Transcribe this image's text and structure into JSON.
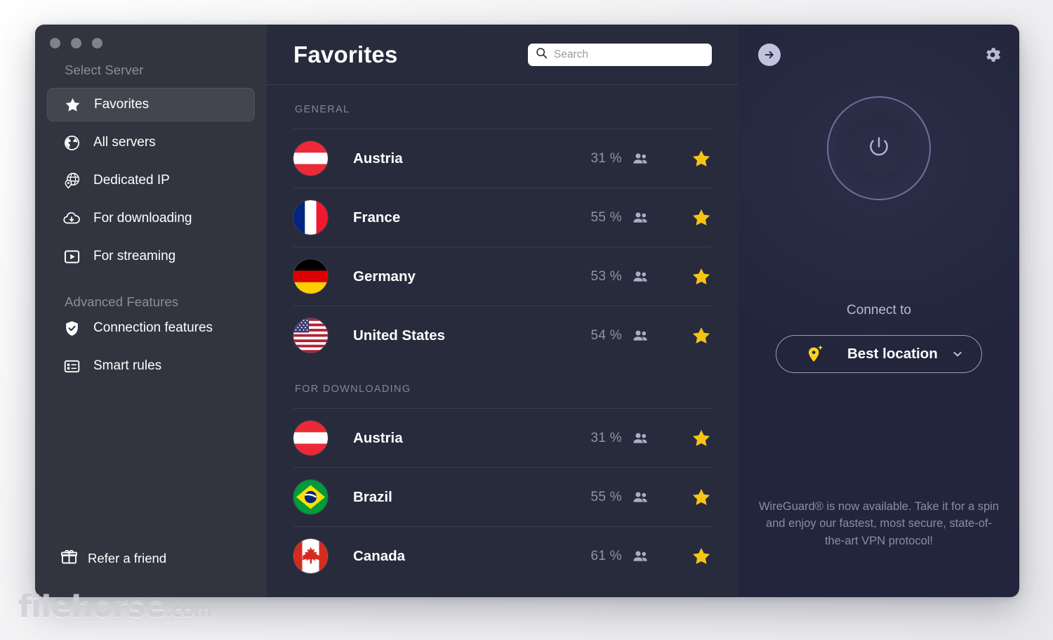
{
  "window": {
    "traffic_lights": [
      "close",
      "minimize",
      "maximize"
    ]
  },
  "sidebar": {
    "header": "Select Server",
    "advanced_header": "Advanced Features",
    "items": [
      {
        "label": "Favorites",
        "icon": "star-icon",
        "active": true
      },
      {
        "label": "All servers",
        "icon": "globe-icon",
        "active": false
      },
      {
        "label": "Dedicated IP",
        "icon": "dedicated-ip-globe-pin-icon",
        "active": false
      },
      {
        "label": "For downloading",
        "icon": "cloud-download-icon",
        "active": false
      },
      {
        "label": "For streaming",
        "icon": "play-screen-icon",
        "active": false
      }
    ],
    "advanced_items": [
      {
        "label": "Connection features",
        "icon": "shield-check-icon",
        "active": false
      },
      {
        "label": "Smart rules",
        "icon": "smart-rules-list-icon",
        "active": false
      }
    ],
    "refer": {
      "label": "Refer a friend",
      "icon": "gift-icon"
    }
  },
  "main": {
    "title": "Favorites",
    "search": {
      "value": "",
      "placeholder": "Search",
      "icon": "search-icon"
    },
    "sections": [
      {
        "label": "GENERAL",
        "rows": [
          {
            "country": "Austria",
            "flag": "at",
            "load": "31 %",
            "users_icon": "people-icon",
            "favorite": true
          },
          {
            "country": "France",
            "flag": "fr",
            "load": "55 %",
            "users_icon": "people-icon",
            "favorite": true
          },
          {
            "country": "Germany",
            "flag": "de",
            "load": "53 %",
            "users_icon": "people-icon",
            "favorite": true
          },
          {
            "country": "United States",
            "flag": "us",
            "load": "54 %",
            "users_icon": "people-icon",
            "favorite": true
          }
        ]
      },
      {
        "label": "FOR DOWNLOADING",
        "rows": [
          {
            "country": "Austria",
            "flag": "at",
            "load": "31 %",
            "users_icon": "people-icon",
            "favorite": true
          },
          {
            "country": "Brazil",
            "flag": "br",
            "load": "55 %",
            "users_icon": "people-icon",
            "favorite": true
          },
          {
            "country": "Canada",
            "flag": "ca",
            "load": "61 %",
            "users_icon": "people-icon",
            "favorite": true
          }
        ]
      }
    ]
  },
  "right_panel": {
    "back_icon": "arrow-right-circle-icon",
    "settings_icon": "gear-icon",
    "power_icon": "power-icon",
    "connect_label": "Connect to",
    "location": {
      "label": "Best location",
      "icon": "best-location-pin-icon",
      "chevron": "chevron-down-icon"
    },
    "promo_text": "WireGuard® is now available. Take it for a spin and enjoy our fastest, most secure, state-of-the-art VPN protocol!"
  },
  "watermark": {
    "name": "filehorse",
    "suffix": ".com"
  },
  "colors": {
    "sidebar_bg": "#32343f",
    "main_bg": "#282b3c",
    "right_bg": "#22253b",
    "accent_star": "#F6C414",
    "accent_pin": "#FFD21E",
    "muted_text": "#82859a"
  }
}
